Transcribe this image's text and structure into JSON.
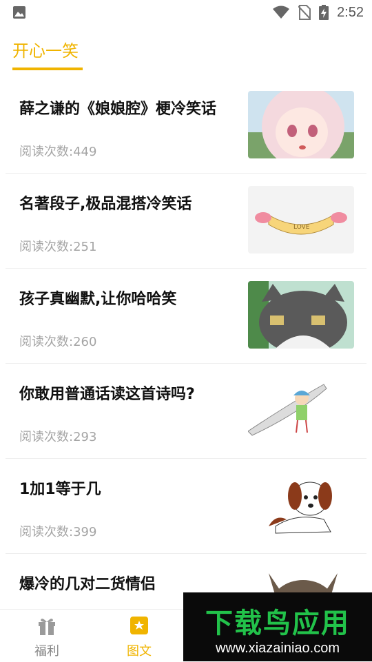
{
  "status_bar": {
    "time": "2:52"
  },
  "header": {
    "tab_title": "开心一笑"
  },
  "list": {
    "items": [
      {
        "title": "薛之谦的《娘娘腔》梗冷笑话",
        "reads": "阅读次数:449",
        "thumb": "anime-girl-image"
      },
      {
        "title": "名著段子,极品混搭冷笑话",
        "reads": "阅读次数:251",
        "thumb": "love-ribbon-image"
      },
      {
        "title": "孩子真幽默,让你哈哈笑",
        "reads": "阅读次数:260",
        "thumb": "cartoon-cat-image"
      },
      {
        "title": "你敢用普通话读这首诗吗?",
        "reads": "阅读次数:293",
        "thumb": "cartoon-girl-knife-image"
      },
      {
        "title": "1加1等于几",
        "reads": "阅读次数:399",
        "thumb": "cartoon-dog-image"
      },
      {
        "title": "爆冷的几对二货情侣",
        "reads": "",
        "thumb": "cartoon-rabbit-image"
      }
    ]
  },
  "bottom_nav": {
    "fuli_label": "福利",
    "tuwen_label": "图文"
  },
  "watermark": {
    "main": "下载鸟应用",
    "url": "www.xiazainiao.com"
  },
  "colors": {
    "accent": "#f0b400",
    "muted": "#a5a5a5",
    "watermark_green": "#22c24a"
  }
}
